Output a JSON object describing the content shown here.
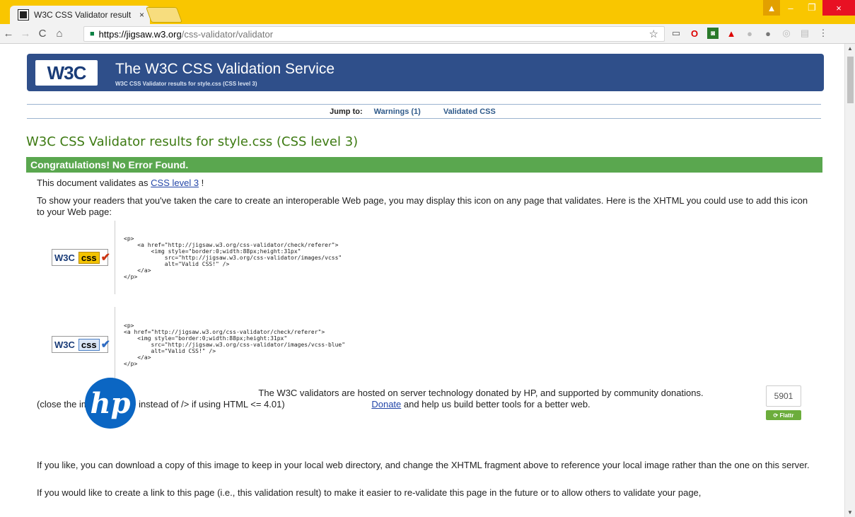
{
  "browser": {
    "tab_title": "W3C CSS Validator result",
    "tab_close": "×",
    "url_host": "https://jigsaw.w3.org",
    "url_path": "/css-validator/validator",
    "win_minimize": "–",
    "win_restore": "❐",
    "win_close": "×",
    "user_icon": "▲",
    "menu_glyph": "⋮"
  },
  "banner": {
    "logo_text": "W3C",
    "title": "The W3C CSS Validation Service",
    "subtitle": "W3C CSS Validator results for style.css (CSS level 3)"
  },
  "jump": {
    "label": "Jump to:",
    "links": [
      "Warnings (1)",
      "Validated CSS"
    ]
  },
  "results": {
    "title": "W3C CSS Validator results for style.css (CSS level 3)",
    "congrats": "Congratulations! No Error Found.",
    "validates_prefix": "This document validates as ",
    "validates_link": "CSS level 3",
    "validates_suffix": " !",
    "interop_text": "To show your readers that you've taken the care to create an interoperable Web page, you may display this icon on any page that validates. Here is the XHTML you could use to add this icon to your Web page:",
    "badges": [
      {
        "w3": "W3C",
        "css": "css",
        "check": "✔"
      },
      {
        "w3": "W3C",
        "css": "css",
        "check": "✔"
      }
    ],
    "code_gold": "<p>\n    <a href=\"http://jigsaw.w3.org/css-validator/check/referer\">\n        <img style=\"border:0;width:88px;height:31px\"\n            src=\"http://jigsaw.w3.org/css-validator/images/vcss\"\n            alt=\"Valid CSS!\" />\n    </a>\n</p>",
    "code_blue": "<p>\n<a href=\"http://jigsaw.w3.org/css-validator/check/referer\">\n    <img style=\"border:0;width:88px;height:31px\"\n        src=\"http://jigsaw.w3.org/css-validator/images/vcss-blue\"\n        alt=\"Valid CSS!\" />\n    </a>\n</p>",
    "close_img_note": "(close the img tag with > instead of /> if using HTML <= 4.01)"
  },
  "sponsor": {
    "logo_text": "hp",
    "line1": "The W3C validators are hosted on server technology donated by HP, and supported by community donations.",
    "donate_link": "Donate",
    "line2_suffix": " and help us build better tools for a better web.",
    "flattr_count": "5901",
    "flattr_label": "⟳ Flattr"
  },
  "footer": {
    "download_text": "If you like, you can download a copy of this image to keep in your local web directory, and change the XHTML fragment above to reference your local image rather than the one on this server.",
    "link_text": "If you would like to create a link to this page (i.e., this validation result) to make it easier to re-validate this page in the future or to allow others to validate your page,"
  }
}
